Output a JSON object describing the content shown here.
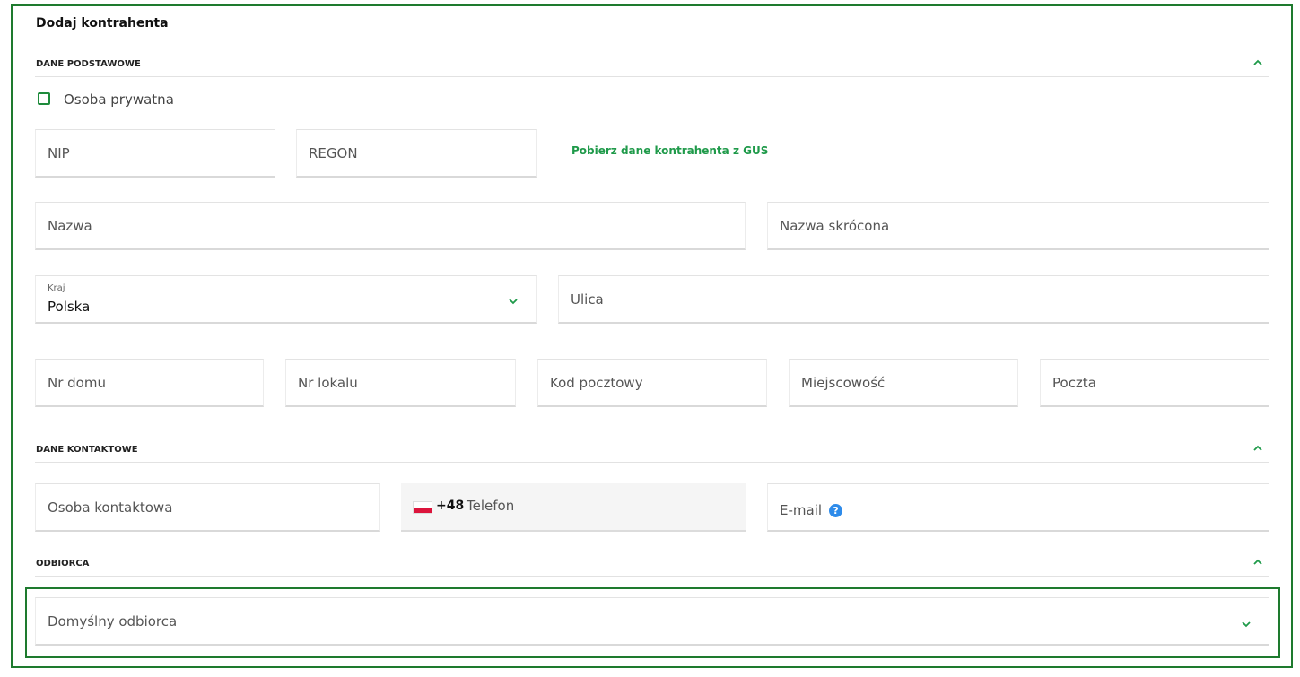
{
  "title": "Dodaj kontrahenta",
  "sections": {
    "basic": {
      "label": "DANE PODSTAWOWE"
    },
    "contact": {
      "label": "DANE KONTAKTOWE"
    },
    "recipient": {
      "label": "ODBIORCA"
    }
  },
  "private_person": {
    "label": "Osoba prywatna",
    "checked": false
  },
  "fields": {
    "nip": "NIP",
    "regon": "REGON",
    "name": "Nazwa",
    "short_name": "Nazwa skrócona",
    "street": "Ulica",
    "house_no": "Nr domu",
    "apartment_no": "Nr lokalu",
    "postal_code": "Kod pocztowy",
    "city": "Miejscowość",
    "post": "Poczta",
    "contact_person": "Osoba kontaktowa",
    "phone": "Telefon",
    "email": "E-mail"
  },
  "gus_link": "Pobierz dane kontrahenta z GUS",
  "country": {
    "label": "Kraj",
    "value": "Polska"
  },
  "phone_prefix": "+48",
  "recipient_select": {
    "placeholder": "Domyślny odbiorca"
  },
  "colors": {
    "accent": "#1f9a4a",
    "frame": "#1e7a2e",
    "help": "#2e8bea"
  },
  "icons": {
    "collapse": "chevron-up-icon",
    "dropdown": "chevron-down-icon",
    "flag": "poland-flag-icon",
    "help": "question-icon"
  }
}
